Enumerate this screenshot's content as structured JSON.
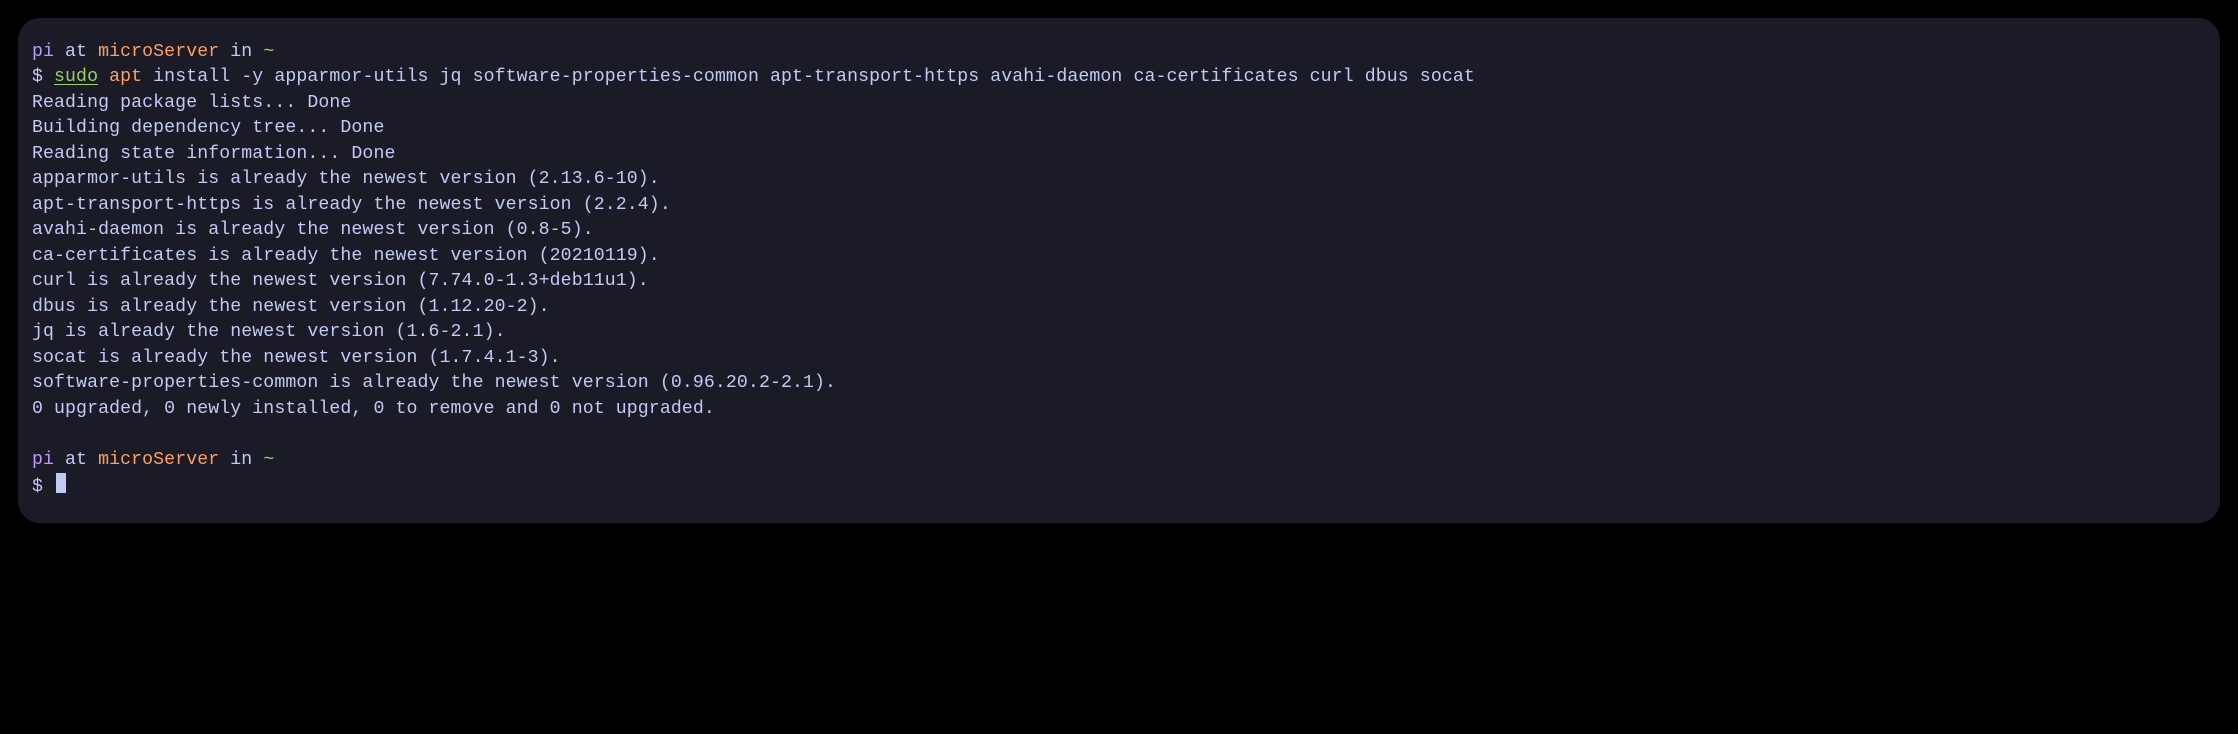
{
  "prompt1": {
    "user": "pi",
    "at": " at ",
    "host": "microServer",
    "in": " in ",
    "cwd": "~"
  },
  "command": {
    "dollar": "$ ",
    "sudo": "sudo",
    "space1": " ",
    "apt": "apt",
    "rest": " install -y apparmor-utils jq software-properties-common apt-transport-https avahi-daemon ca-certificates curl dbus socat"
  },
  "output_lines": [
    "Reading package lists... Done",
    "Building dependency tree... Done",
    "Reading state information... Done",
    "apparmor-utils is already the newest version (2.13.6-10).",
    "apt-transport-https is already the newest version (2.2.4).",
    "avahi-daemon is already the newest version (0.8-5).",
    "ca-certificates is already the newest version (20210119).",
    "curl is already the newest version (7.74.0-1.3+deb11u1).",
    "dbus is already the newest version (1.12.20-2).",
    "jq is already the newest version (1.6-2.1).",
    "socat is already the newest version (1.7.4.1-3).",
    "software-properties-common is already the newest version (0.96.20.2-2.1).",
    "0 upgraded, 0 newly installed, 0 to remove and 0 not upgraded."
  ],
  "prompt2": {
    "user": "pi",
    "at": " at ",
    "host": "microServer",
    "in": " in ",
    "cwd": "~",
    "dollar": "$ "
  }
}
